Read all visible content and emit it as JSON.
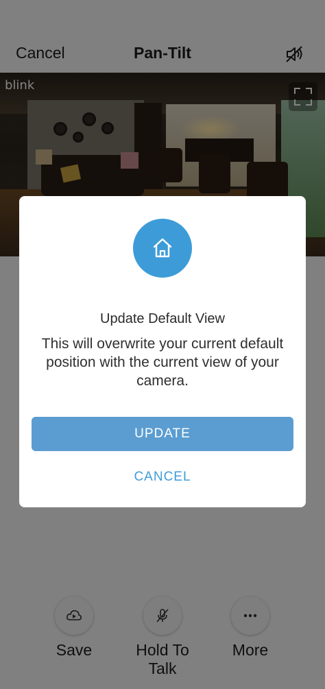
{
  "header": {
    "cancel_label": "Cancel",
    "title": "Pan-Tilt",
    "mute_icon": "speaker-muted-icon"
  },
  "camera_feed": {
    "brand_watermark": "blink",
    "fullscreen_icon": "fullscreen-icon"
  },
  "controls": [
    {
      "label": "Save",
      "icon": "cloud-play-icon"
    },
    {
      "label": "Hold To Talk",
      "icon": "microphone-muted-icon"
    },
    {
      "label": "More",
      "icon": "more-dots-icon"
    }
  ],
  "dialog": {
    "icon": "home-icon",
    "title": "Update Default View",
    "message": "This will overwrite your current default position with the current view of your camera.",
    "primary_button": "UPDATE",
    "secondary_button": "CANCEL"
  },
  "colors": {
    "accent": "#3d9cd8",
    "update_button": "#5b9dd1",
    "overlay": "#000000"
  }
}
